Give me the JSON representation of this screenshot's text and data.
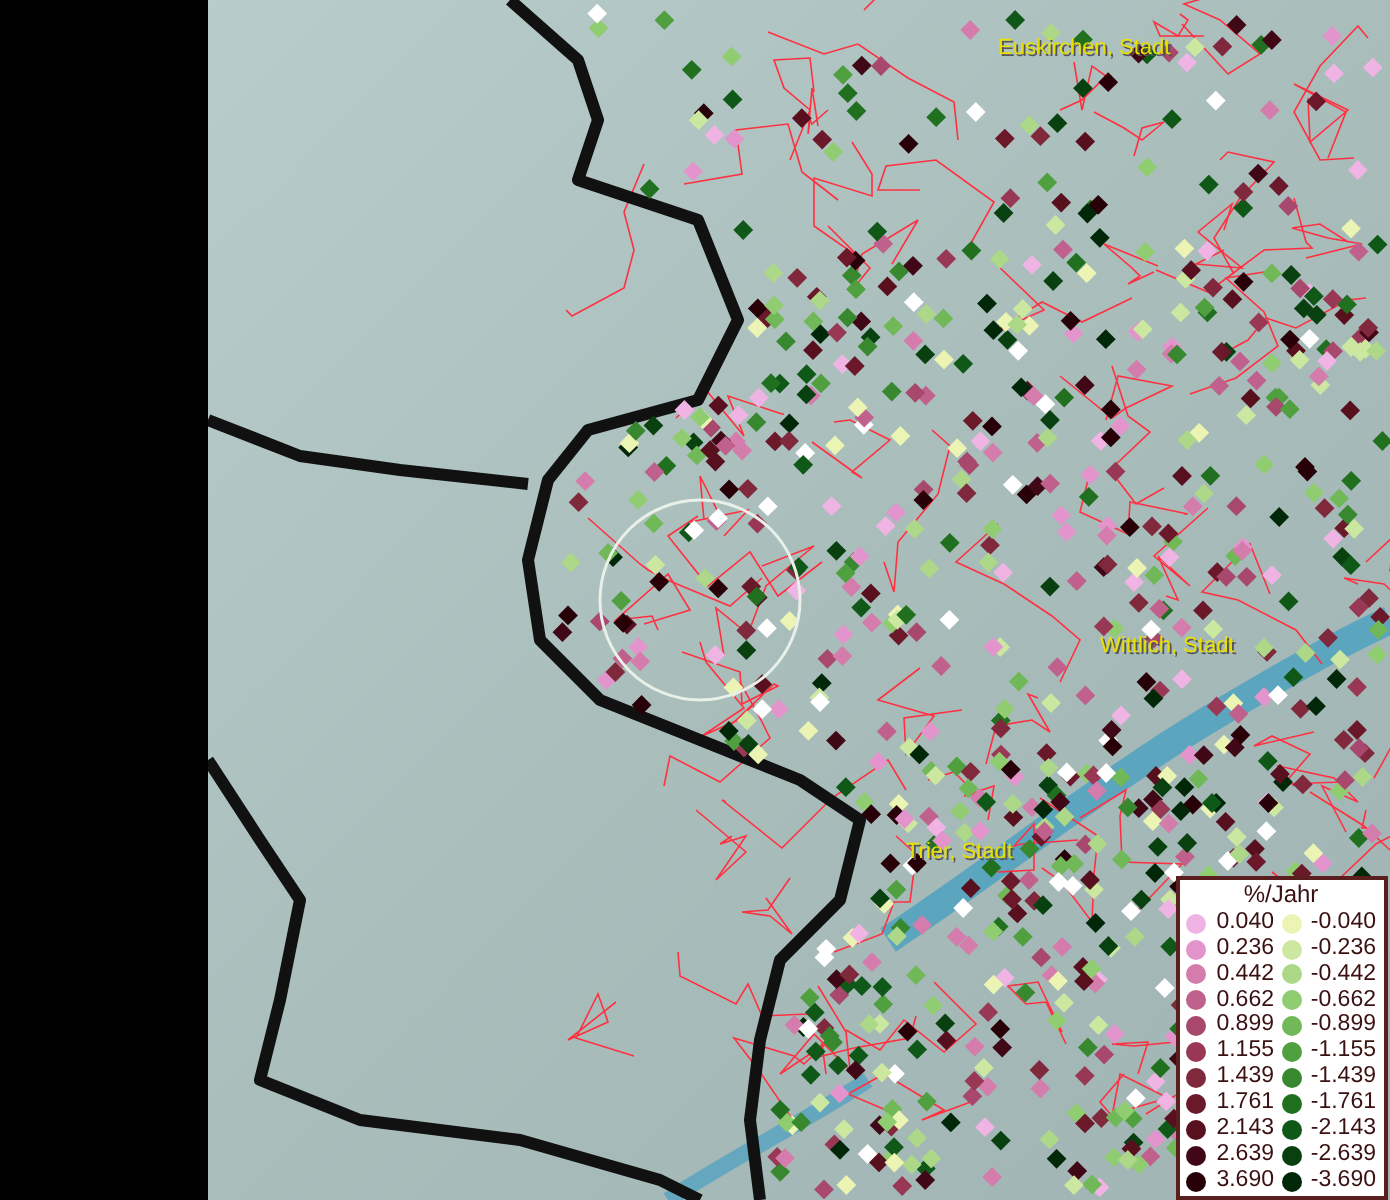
{
  "map": {
    "place_labels": [
      {
        "label": "Euskirchen, Stadt"
      },
      {
        "label": "Wittlich, Stadt"
      },
      {
        "label": "Trier, Stadt"
      }
    ]
  },
  "legend": {
    "title": "%/Jahr",
    "positive": [
      {
        "label": "0.040",
        "color": "#f0b4e4"
      },
      {
        "label": "0.236",
        "color": "#e494cc"
      },
      {
        "label": "0.442",
        "color": "#d47cac"
      },
      {
        "label": "0.662",
        "color": "#c0608c"
      },
      {
        "label": "0.899",
        "color": "#a8486c"
      },
      {
        "label": "1.155",
        "color": "#983854"
      },
      {
        "label": "1.439",
        "color": "#80283c"
      },
      {
        "label": "1.761",
        "color": "#6a182a"
      },
      {
        "label": "2.143",
        "color": "#58101e"
      },
      {
        "label": "2.639",
        "color": "#400816"
      },
      {
        "label": "3.690",
        "color": "#280008"
      }
    ],
    "negative": [
      {
        "label": "-0.040",
        "color": "#ecf4b4"
      },
      {
        "label": "-0.236",
        "color": "#cce8a0"
      },
      {
        "label": "-0.442",
        "color": "#acd888"
      },
      {
        "label": "-0.662",
        "color": "#90cc70"
      },
      {
        "label": "-0.899",
        "color": "#70b858"
      },
      {
        "label": "-1.155",
        "color": "#50a040"
      },
      {
        "label": "-1.439",
        "color": "#388830"
      },
      {
        "label": "-1.761",
        "color": "#207020"
      },
      {
        "label": "-2.143",
        "color": "#105818"
      },
      {
        "label": "-2.639",
        "color": "#084010"
      },
      {
        "label": "-3.690",
        "color": "#002808"
      }
    ]
  }
}
